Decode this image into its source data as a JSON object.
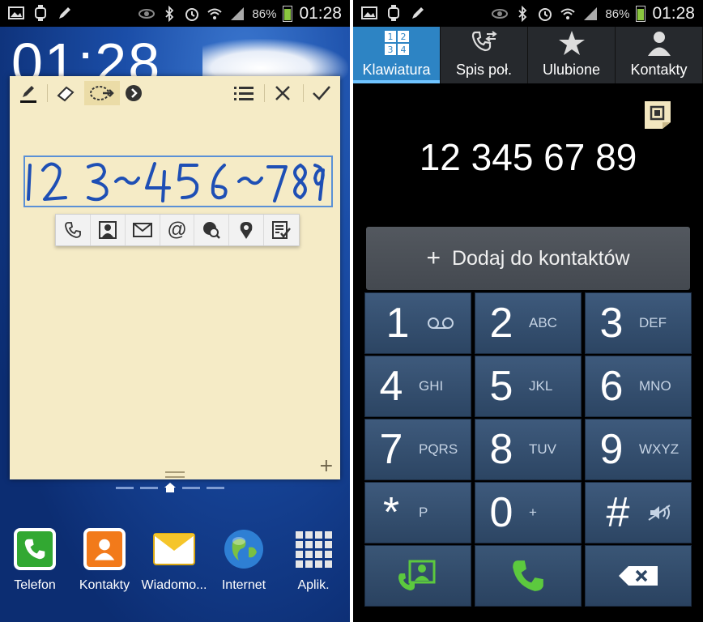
{
  "left": {
    "status_bar": {
      "battery": "86%",
      "time": "01:28"
    },
    "clock": "01:28",
    "memo": {
      "handwriting": "123-456-789",
      "toolbar": [
        "pen-icon",
        "eraser-icon",
        "lasso-select-icon",
        "more-arrow-icon",
        "list-icon",
        "close-icon",
        "confirm-check-icon"
      ],
      "actions": [
        "phone-icon",
        "contact-icon",
        "email-icon",
        "at-icon",
        "web-search-icon",
        "location-icon",
        "task-icon"
      ]
    },
    "dock": [
      {
        "label": "Telefon",
        "icon": "phone-app-icon",
        "color": "#32a832"
      },
      {
        "label": "Kontakty",
        "icon": "contacts-app-icon",
        "color": "#f27a1a"
      },
      {
        "label": "Wiadomo...",
        "icon": "messages-app-icon",
        "color": "#f5c52a"
      },
      {
        "label": "Internet",
        "icon": "globe-app-icon",
        "color": "#2e7fd4"
      },
      {
        "label": "Aplik.",
        "icon": "apps-grid-icon",
        "color": "#dddddd"
      }
    ]
  },
  "right": {
    "status_bar": {
      "battery": "86%",
      "time": "01:28"
    },
    "tabs": [
      {
        "label": "Klawiatura",
        "icon": "keypad-icon",
        "active": true
      },
      {
        "label": "Spis poł.",
        "icon": "call-log-icon",
        "active": false
      },
      {
        "label": "Ulubione",
        "icon": "star-icon",
        "active": false
      },
      {
        "label": "Kontakty",
        "icon": "person-icon",
        "active": false
      }
    ],
    "dialed_number": "12 345 67 89",
    "add_contact_label": "Dodaj do kontaktów",
    "keys": [
      {
        "digit": "1",
        "sub": "",
        "sub_icon": "voicemail-icon"
      },
      {
        "digit": "2",
        "sub": "ABC"
      },
      {
        "digit": "3",
        "sub": "DEF"
      },
      {
        "digit": "4",
        "sub": "GHI"
      },
      {
        "digit": "5",
        "sub": "JKL"
      },
      {
        "digit": "6",
        "sub": "MNO"
      },
      {
        "digit": "7",
        "sub": "PQRS"
      },
      {
        "digit": "8",
        "sub": "TUV"
      },
      {
        "digit": "9",
        "sub": "WXYZ"
      },
      {
        "digit": "*",
        "sub": "P"
      },
      {
        "digit": "0",
        "sub": "+"
      },
      {
        "digit": "#",
        "sub": "",
        "sub_icon": "mute-icon"
      }
    ],
    "bottom_row": [
      "contacts-dial-icon",
      "call-icon",
      "backspace-icon"
    ],
    "accent": "#2d84c4",
    "call_green": "#5cc93e"
  }
}
